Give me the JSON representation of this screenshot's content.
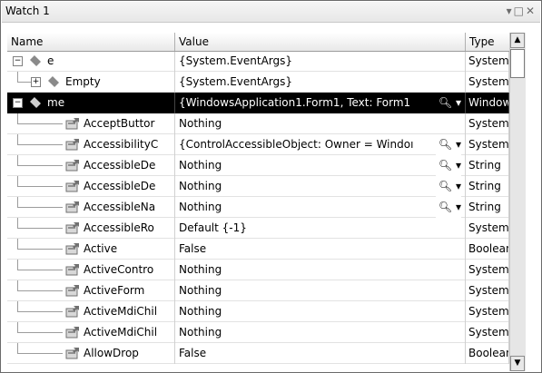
{
  "window": {
    "title": "Watch 1",
    "icons": [
      "dropdown-icon",
      "restore-icon",
      "close-icon"
    ]
  },
  "columns": {
    "name": "Name",
    "value": "Value",
    "type": "Type"
  },
  "rows": [
    {
      "name": "e",
      "value": "{System.EventArgs}",
      "type": "System.E",
      "icon": "field-icon",
      "expander": "minus",
      "level": 0,
      "selected": false,
      "magnifier": false
    },
    {
      "name": "Empty",
      "value": "{System.EventArgs}",
      "type": "System.E",
      "icon": "field-icon",
      "expander": "plus",
      "level": 1,
      "selected": false,
      "magnifier": false
    },
    {
      "name": "me",
      "value": "{WindowsApplication1.Form1, Text: Form1",
      "type": "Windows/",
      "icon": "field-icon",
      "expander": "minus",
      "level": 0,
      "selected": true,
      "magnifier": true
    },
    {
      "name": "AcceptButtor",
      "value": "Nothing",
      "type": "System.W",
      "icon": "property-icon",
      "level": 1,
      "selected": false,
      "magnifier": false
    },
    {
      "name": "AccessibilityC",
      "value": "{ControlAccessibleObject: Owner = Windoı",
      "type": "System.W",
      "icon": "property-icon",
      "level": 1,
      "selected": false,
      "magnifier": true
    },
    {
      "name": "AccessibleDe",
      "value": "Nothing",
      "type": "String",
      "icon": "property-icon",
      "level": 1,
      "selected": false,
      "magnifier": true
    },
    {
      "name": "AccessibleDe",
      "value": "Nothing",
      "type": "String",
      "icon": "property-icon",
      "level": 1,
      "selected": false,
      "magnifier": true
    },
    {
      "name": "AccessibleNa",
      "value": "Nothing",
      "type": "String",
      "icon": "property-icon",
      "level": 1,
      "selected": false,
      "magnifier": true
    },
    {
      "name": "AccessibleRo",
      "value": "Default {-1}",
      "type": "System.W",
      "icon": "property-icon",
      "level": 1,
      "selected": false,
      "magnifier": false
    },
    {
      "name": "Active",
      "value": "False",
      "type": "Boolean",
      "icon": "property-icon",
      "level": 1,
      "selected": false,
      "magnifier": false
    },
    {
      "name": "ActiveContro",
      "value": "Nothing",
      "type": "System.W",
      "icon": "property-icon",
      "level": 1,
      "selected": false,
      "magnifier": false
    },
    {
      "name": "ActiveForm",
      "value": "Nothing",
      "type": "System.W",
      "icon": "property-icon",
      "level": 1,
      "selected": false,
      "magnifier": false
    },
    {
      "name": "ActiveMdiChil",
      "value": "Nothing",
      "type": "System.W",
      "icon": "property-icon",
      "level": 1,
      "selected": false,
      "magnifier": false
    },
    {
      "name": "ActiveMdiChil",
      "value": "Nothing",
      "type": "System.W",
      "icon": "property-icon",
      "level": 1,
      "selected": false,
      "magnifier": false
    },
    {
      "name": "AllowDrop",
      "value": "False",
      "type": "Boolean",
      "icon": "property-icon",
      "level": 1,
      "selected": false,
      "magnifier": false
    }
  ],
  "colors": {
    "selection": "#000000",
    "border": "#6b6b6b"
  }
}
